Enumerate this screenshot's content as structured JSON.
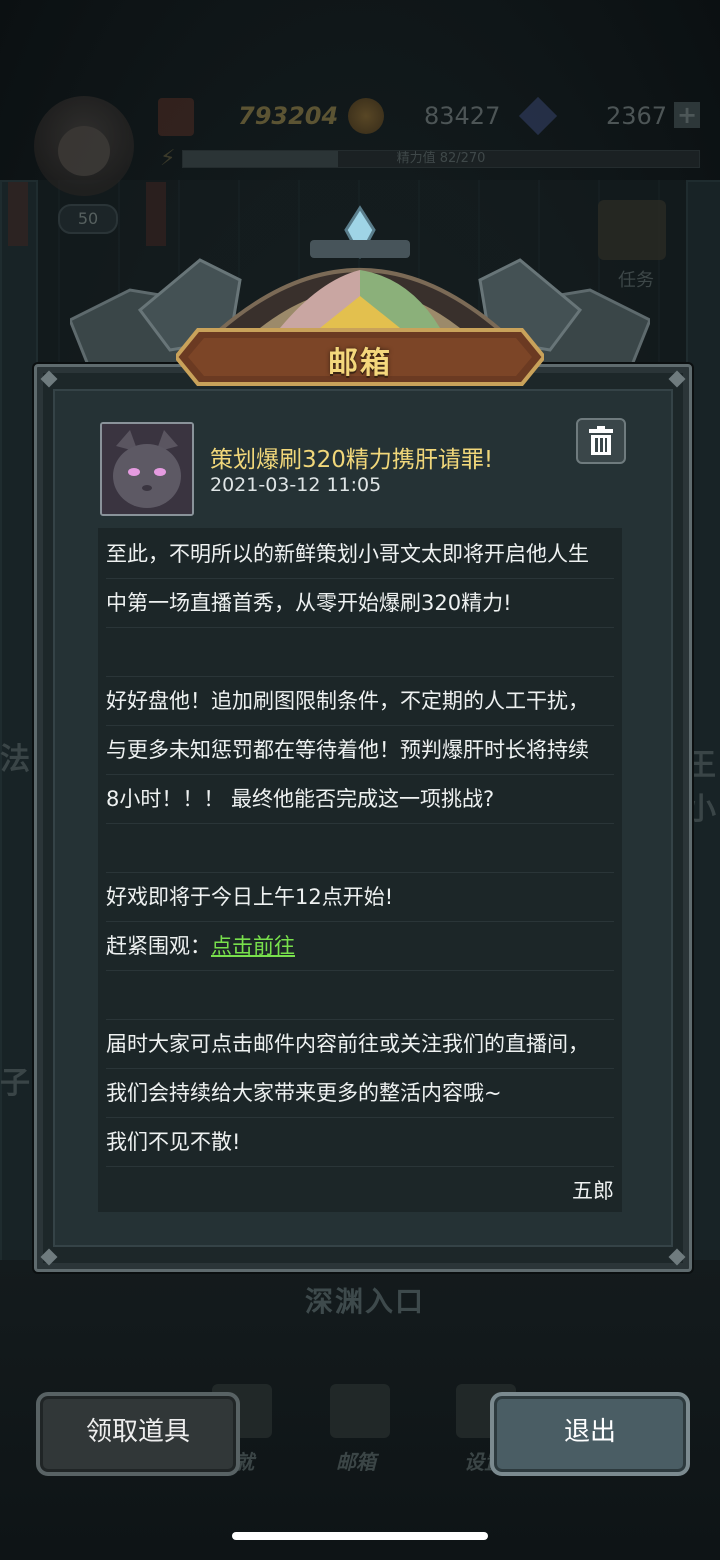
{
  "hud": {
    "level": "50",
    "power": "793204",
    "coins": "83427",
    "gems": "2367",
    "plus": "+",
    "energy_text": "精力值 82/270",
    "energy_fraction": 0.3
  },
  "background": {
    "task_label": "任务",
    "abyss_entrance": "深渊入口",
    "left_fragment_1": "魔法",
    "left_fragment_2": "箱子",
    "right_fragment": "王小"
  },
  "modal": {
    "title": "邮箱",
    "mail": {
      "subject": "策划爆刷320精力携肝请罪!",
      "time": "2021-03-12 11:05",
      "lines": [
        "至此，不明所以的新鲜策划小哥文太即将开启他人生",
        "中第一场直播首秀，从零开始爆刷320精力!",
        "",
        "好好盘他！追加刷图限制条件，不定期的人工干扰，",
        "与更多未知惩罚都在等待着他！预判爆肝时长将持续",
        "8小时！！！ 最终他能否完成这一项挑战?",
        "",
        "好戏即将于今日上午12点开始!",
        "赶紧围观：",
        "",
        "届时大家可点击邮件内容前往或关注我们的直播间，",
        "我们会持续给大家带来更多的整活内容哦~",
        "我们不见不散!"
      ],
      "link_text": "点击前往",
      "signature": "五郎"
    }
  },
  "buttons": {
    "claim": "领取道具",
    "exit": "退出"
  },
  "dock": {
    "achievement": "成就",
    "mailbox": "邮箱",
    "settings": "设置"
  },
  "colors": {
    "title_gold": "#f4d77c",
    "link_green": "#78e04c",
    "panel": "#1d2729"
  }
}
